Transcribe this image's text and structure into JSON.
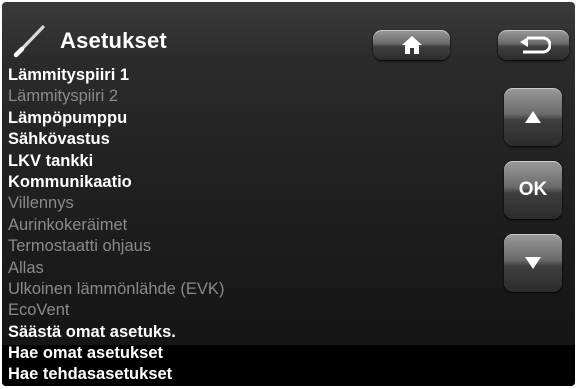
{
  "header": {
    "title": "Asetukset",
    "icon": "screwdriver-icon"
  },
  "menu": {
    "items": [
      {
        "label": "Lämmityspiiri 1",
        "enabled": true
      },
      {
        "label": "Lämmityspiiri 2",
        "enabled": false
      },
      {
        "label": "Lämpöpumppu",
        "enabled": true
      },
      {
        "label": "Sähkövastus",
        "enabled": true
      },
      {
        "label": "LKV tankki",
        "enabled": true
      },
      {
        "label": "Kommunikaatio",
        "enabled": true
      },
      {
        "label": "Villennys",
        "enabled": false
      },
      {
        "label": "Aurinkokeräimet",
        "enabled": false
      },
      {
        "label": "Termostaatti ohjaus",
        "enabled": false
      },
      {
        "label": "Allas",
        "enabled": false
      },
      {
        "label": "Ulkoinen lämmönlähde (EVK)",
        "enabled": false
      },
      {
        "label": "EcoVent",
        "enabled": false
      },
      {
        "label": "Säästä omat asetuks.",
        "enabled": true
      },
      {
        "label": "Hae omat asetukset",
        "enabled": true
      },
      {
        "label": "Hae tehdasasetukset",
        "enabled": true
      }
    ]
  },
  "buttons": {
    "home_icon": "home-icon",
    "back_icon": "back-arrow-icon",
    "up_icon": "up-arrow-icon",
    "ok_label": "OK",
    "down_icon": "down-arrow-icon"
  },
  "colors": {
    "enabled_text": "#ffffff",
    "disabled_text": "#8a8a8a",
    "background": "#1f1f1f"
  }
}
